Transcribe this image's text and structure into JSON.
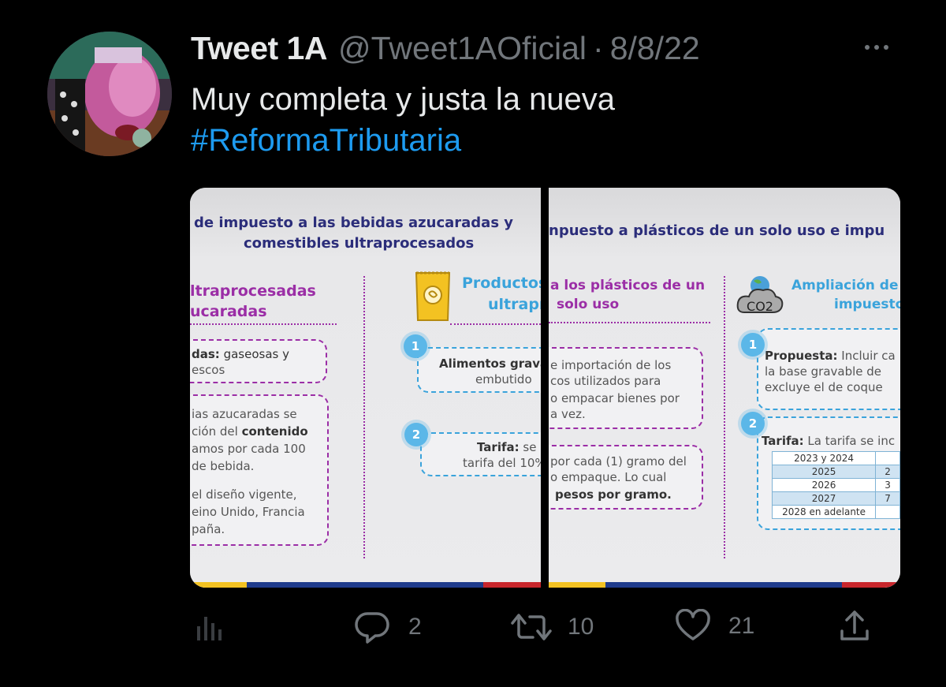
{
  "tweet": {
    "author_name": "Tweet 1A",
    "handle": "@Tweet1AOficial",
    "separator": "·",
    "date": "8/8/22",
    "text_line1": "Muy completa y justa la nueva",
    "hashtag": "#ReformaTributaria"
  },
  "media": {
    "left": {
      "title_line1": "de impuesto a las bebidas azucaradas y",
      "title_line2": "comestibles ultraprocesados",
      "col1_heading_line1": "ltraprocesadas",
      "col1_heading_line2": "ucaradas",
      "box1_bold": "das:",
      "box1_text": "gaseosas y",
      "box1_line2": "escos",
      "box2_line1": "ias azucaradas se",
      "box2_line2_a": "ción del",
      "box2_line2_bold": "contenido",
      "box2_line3": "amos por cada 100",
      "box2_line4": "de bebida.",
      "box2_line5": "el diseño vigente,",
      "box2_line6": "eino Unido, Francia",
      "box2_line7": "paña.",
      "col2_heading_line1": "Productos",
      "col2_heading_line2": "ultrapr",
      "step1_num": "1",
      "step1_bold": "Alimentos grava",
      "step1_line2": "embutido",
      "step2_num": "2",
      "step2_bold": "Tarifa:",
      "step2_text": "se p",
      "step2_line2": "tarifa del 10%"
    },
    "right": {
      "title": "npuesto a plásticos de un solo uso e impu",
      "col1_heading_line1": "a los plásticos de un",
      "col1_heading_line2": "solo uso",
      "box1_line1": "e importación de los",
      "box1_line2": "cos utilizados para",
      "box1_line3": "o empacar bienes por",
      "box1_line4": "a vez.",
      "box2_line1": "por cada (1) gramo del",
      "box2_line2": "o empaque. Lo cual",
      "box2_line3_bold": "pesos por gramo.",
      "col2_heading_line1": "Ampliación de",
      "col2_heading_line2": "impuesto",
      "co2_label": "CO2",
      "step1_num": "1",
      "step1_bold": "Propuesta:",
      "step1_text": "Incluir ca",
      "step1_line2": "la base gravable de",
      "step1_line3": "excluye el de coque",
      "step2_num": "2",
      "step2_bold": "Tarifa:",
      "step2_text": "La tarifa se inc",
      "table_rows": [
        "2023 y 2024",
        "2025",
        "2026",
        "2027",
        "2028 en adelante"
      ],
      "table_col2": [
        "",
        "2",
        "3",
        "7",
        ""
      ]
    }
  },
  "actions": {
    "replies": "2",
    "retweets": "10",
    "likes": "21"
  },
  "icons": {
    "analytics": "analytics-icon",
    "reply": "reply-icon",
    "retweet": "retweet-icon",
    "like": "heart-icon",
    "share": "share-icon",
    "more": "more-icon"
  },
  "colors": {
    "background": "#000000",
    "text": "#e7e9ea",
    "muted": "#71767b",
    "link": "#1d9bf0",
    "flag_yellow": "#f3c222",
    "flag_blue": "#1f3b8c",
    "flag_red": "#c8262c"
  }
}
